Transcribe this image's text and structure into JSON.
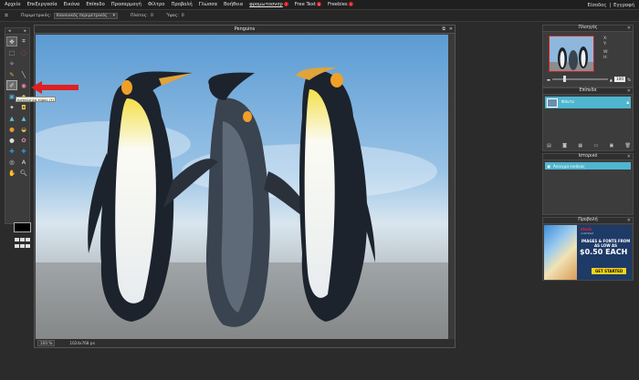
{
  "menu": {
    "items": [
      "Αρχείο",
      "Επεξεργασία",
      "Εικόνα",
      "Επίπεδο",
      "Προσαρμογή",
      "Φίλτρο",
      "Προβολή",
      "Γλώσσα",
      "Βοήθεια"
    ],
    "promo1": {
      "label": "φρομωτοσνσρ",
      "badge": "!"
    },
    "promo2": {
      "label": "Free Text",
      "badge": "1"
    },
    "promo3": {
      "label": "Freebies",
      "badge": "!"
    },
    "login": "Είσοδος",
    "separator": "|",
    "register": "Εγγραφή"
  },
  "options": {
    "perimeter_label": "Περιμετρικός:",
    "perimeter_value": "Κανονικός περιμετρικός",
    "width_label": "Πλάτος:",
    "width_value": "0",
    "height_label": "Ύψος:",
    "height_value": "0"
  },
  "toolbox": {
    "tooltip": "Κατάλληλο εύρος (Y)"
  },
  "document": {
    "title": "Penguins",
    "zoom": "100",
    "zoom_unit": "%",
    "size": "1024x768 px"
  },
  "navigator": {
    "title": "Πλοηγός",
    "x_label": "X:",
    "y_label": "Y:",
    "w_label": "W:",
    "h_label": "H:",
    "zoom": "100",
    "zoom_unit": "%"
  },
  "layers": {
    "title": "Επίπεδα",
    "row_label": "Φόντο"
  },
  "history": {
    "title": "Ιστορικό",
    "row_label": "Άνοιγμα εικόνας"
  },
  "ad": {
    "title": "Προβολή",
    "brand": "stock",
    "brand_sub": "unlimited",
    "line1": "IMAGES & FONTS FROM AS LOW AS",
    "price": "$0.50 EACH",
    "cta": "GET STARTED"
  },
  "colors": {
    "accent": "#4fb6d0",
    "bg": "#2b2b2b",
    "ad_bg": "#1e3a66",
    "cta": "#f3d317",
    "arrow": "#e02020"
  }
}
